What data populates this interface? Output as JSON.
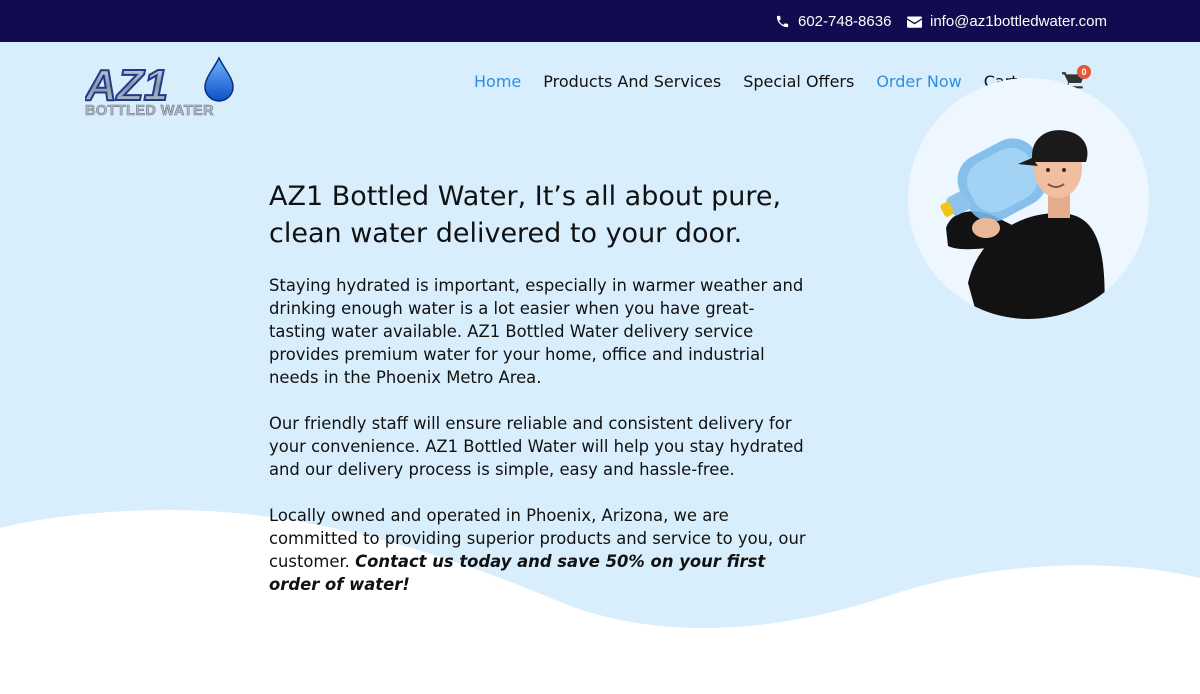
{
  "topbar": {
    "phone": "602-748-8636",
    "email": "info@az1bottledwater.com",
    "phone_icon": "phone-icon",
    "email_icon": "envelope-icon"
  },
  "logo": {
    "line1": "AZ1",
    "line2": "BOTTLED WATER"
  },
  "nav": {
    "items": [
      {
        "label": "Home",
        "active": true
      },
      {
        "label": "Products And Services",
        "active": false
      },
      {
        "label": "Special Offers",
        "active": false
      },
      {
        "label": "Order Now",
        "active": true
      },
      {
        "label": "Cart",
        "active": false
      }
    ]
  },
  "cart": {
    "icon": "cart-icon",
    "count": "0"
  },
  "main": {
    "heading": "AZ1 Bottled Water, It’s all about pure, clean water delivered to your door.",
    "paragraph1": "Staying hydrated is important, especially in warmer weather and drinking enough water is a lot easier when you have great-tasting water available. AZ1 Bottled Water delivery service provides premium water for your home, office and industrial needs in the Phoenix Metro Area.",
    "paragraph2": "Our friendly staff will ensure reliable and consistent delivery for your convenience. AZ1 Bottled Water will help you stay hydrated and our delivery process is simple, easy and hassle-free.",
    "paragraph3_lead": "Locally owned and operated in Phoenix, Arizona, we are committed to providing superior products and service to you, our customer.",
    "paragraph3_emphasis": "Contact us today and save 50% on your first order of water!"
  },
  "colors": {
    "topbar_bg": "#130b4f",
    "hero_bg": "#d9eefd",
    "nav_active": "#2f8ee0",
    "badge": "#e05a3a"
  }
}
